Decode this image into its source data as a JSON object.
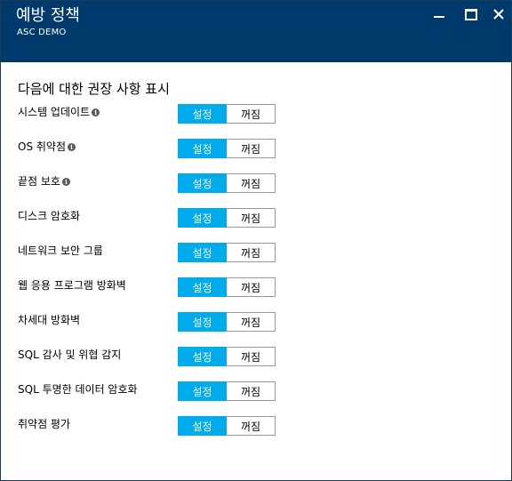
{
  "header": {
    "title": "예방 정책",
    "subtitle": "ASC DEMO",
    "minimize_icon": "minimize-icon",
    "maximize_icon": "maximize-icon",
    "close_icon": "close-icon"
  },
  "section_title": "다음에 대한 권장 사항 표시",
  "toggle": {
    "on": "설정",
    "off": "꺼짐"
  },
  "colors": {
    "header_bg": "#003a6c",
    "accent": "#00abec"
  },
  "policies": [
    {
      "label": "시스템 업데이트",
      "info": true,
      "state": "on"
    },
    {
      "label": "OS 취약점",
      "info": true,
      "state": "on"
    },
    {
      "label": "끝점 보호",
      "info": true,
      "state": "on"
    },
    {
      "label": "디스크 암호화",
      "info": false,
      "state": "on"
    },
    {
      "label": "네트워크 보안 그룹",
      "info": false,
      "state": "on"
    },
    {
      "label": "웹 응용 프로그램 방화벽",
      "info": false,
      "state": "on"
    },
    {
      "label": "차세대 방화벽",
      "info": false,
      "state": "on"
    },
    {
      "label": "SQL 감사 및 위협 감지",
      "info": false,
      "state": "on"
    },
    {
      "label": "SQL 투명한 데이터 암호화",
      "info": false,
      "state": "on"
    },
    {
      "label": "취약점 평가",
      "info": false,
      "state": "on"
    }
  ]
}
